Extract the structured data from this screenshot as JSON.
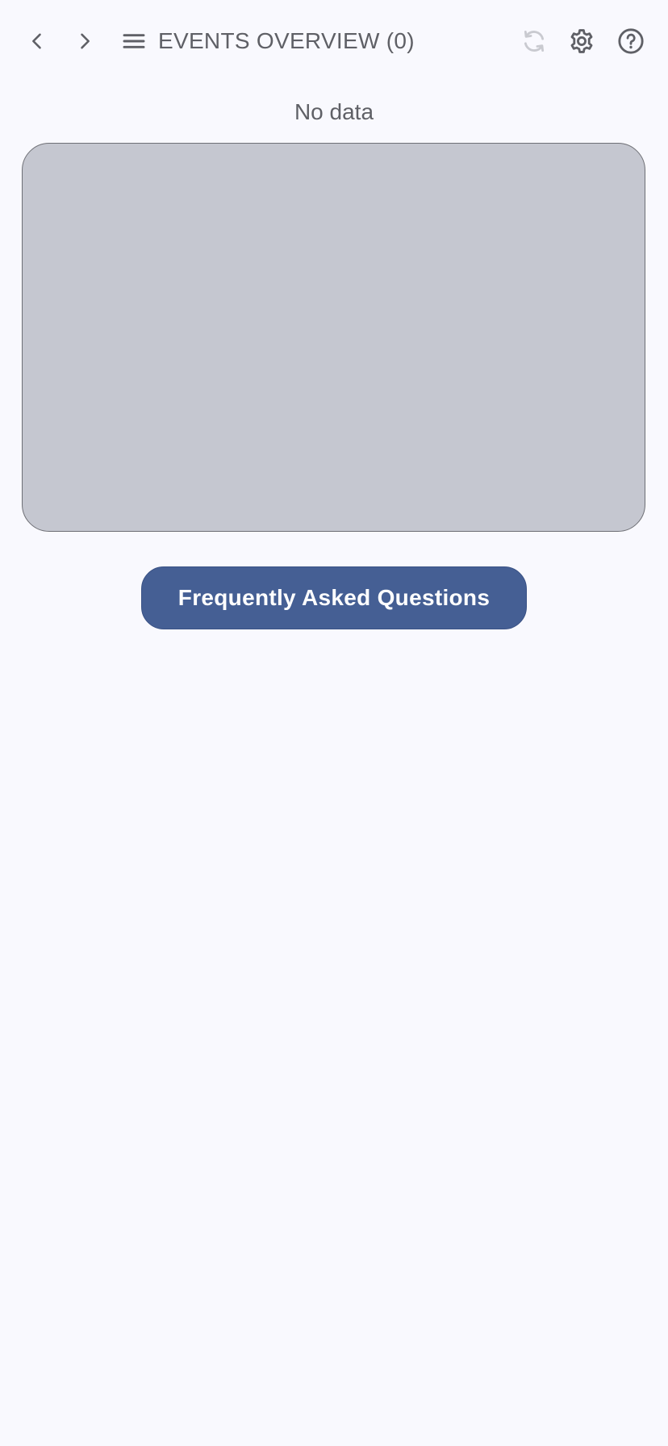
{
  "header": {
    "title": "EVENTS OVERVIEW (0)",
    "icons": {
      "back": "chevron-left-icon",
      "forward": "chevron-right-icon",
      "menu": "hamburger-menu-icon",
      "refresh": "refresh-icon",
      "settings": "gear-icon",
      "help": "help-circle-icon"
    }
  },
  "main": {
    "empty_message": "No data",
    "faq_button_label": "Frequently Asked Questions"
  },
  "colors": {
    "background": "#F9F9FE",
    "text": "#5F6066",
    "placeholder_fill": "#C5C7D0",
    "accent": "#455F94",
    "refresh_disabled": "#C9CAD0"
  }
}
